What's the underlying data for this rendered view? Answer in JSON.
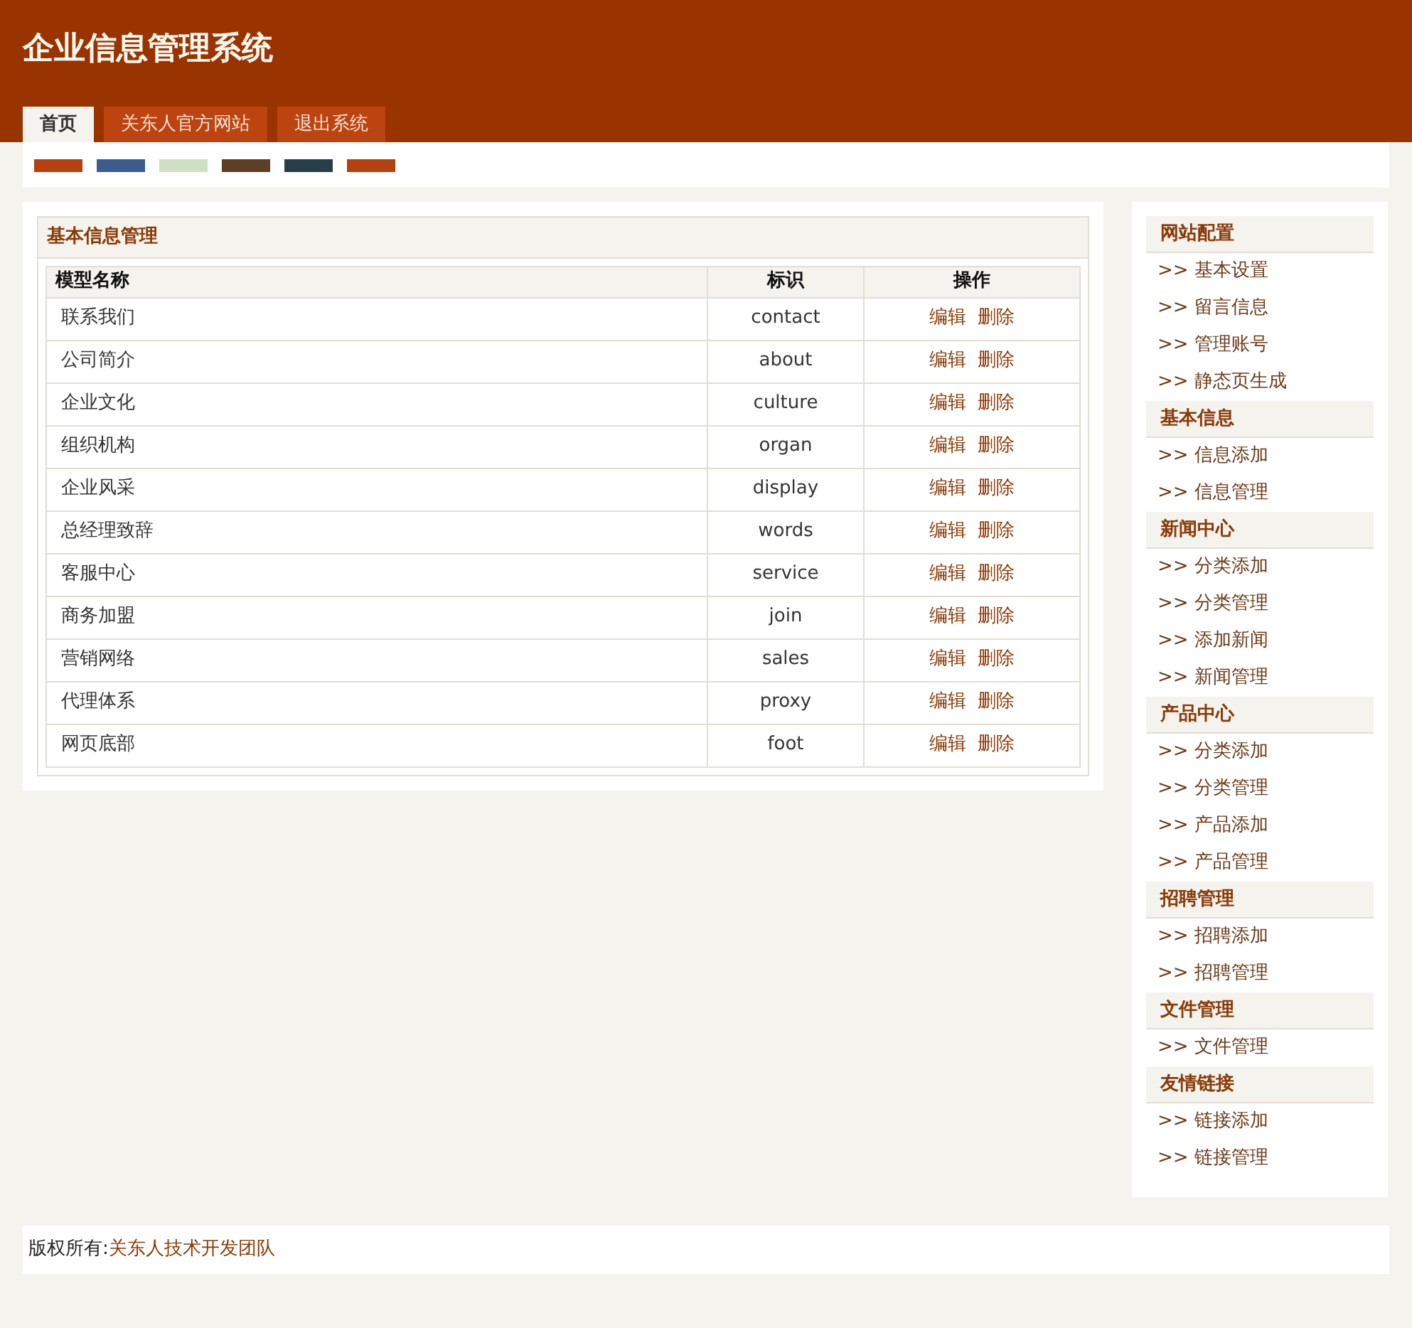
{
  "header": {
    "title": "企业信息管理系统"
  },
  "tabs": [
    {
      "label": "首页",
      "selected": true
    },
    {
      "label": "关东人官方网站",
      "selected": false
    },
    {
      "label": "退出系统",
      "selected": false
    }
  ],
  "theme_swatches": [
    {
      "color": "#b5410f"
    },
    {
      "color": "#3a5c8e"
    },
    {
      "color": "#cfe0c2"
    },
    {
      "color": "#5e3f25"
    },
    {
      "color": "#263e47"
    },
    {
      "color": "#b5410f"
    }
  ],
  "panel": {
    "title": "基本信息管理",
    "columns": [
      "模型名称",
      "标识",
      "操作"
    ],
    "rows": [
      {
        "name": "联系我们",
        "id": "contact",
        "actions": [
          "编辑",
          "删除"
        ]
      },
      {
        "name": "公司简介",
        "id": "about",
        "actions": [
          "编辑",
          "删除"
        ]
      },
      {
        "name": "企业文化",
        "id": "culture",
        "actions": [
          "编辑",
          "删除"
        ]
      },
      {
        "name": "组织机构",
        "id": "organ",
        "actions": [
          "编辑",
          "删除"
        ]
      },
      {
        "name": "企业风采",
        "id": "display",
        "actions": [
          "编辑",
          "删除"
        ]
      },
      {
        "name": "总经理致辞",
        "id": "words",
        "actions": [
          "编辑",
          "删除"
        ]
      },
      {
        "name": "客服中心",
        "id": "service",
        "actions": [
          "编辑",
          "删除"
        ]
      },
      {
        "name": "商务加盟",
        "id": "join",
        "actions": [
          "编辑",
          "删除"
        ]
      },
      {
        "name": "营销网络",
        "id": "sales",
        "actions": [
          "编辑",
          "删除"
        ]
      },
      {
        "name": "代理体系",
        "id": "proxy",
        "actions": [
          "编辑",
          "删除"
        ]
      },
      {
        "name": "网页底部",
        "id": "foot",
        "actions": [
          "编辑",
          "删除"
        ]
      }
    ]
  },
  "sidebar": [
    {
      "title": "网站配置",
      "items": [
        ">> 基本设置",
        ">> 留言信息",
        ">> 管理账号",
        ">> 静态页生成"
      ]
    },
    {
      "title": "基本信息",
      "items": [
        ">> 信息添加",
        ">> 信息管理"
      ]
    },
    {
      "title": "新闻中心",
      "items": [
        ">> 分类添加",
        ">> 分类管理",
        ">> 添加新闻",
        ">> 新闻管理"
      ]
    },
    {
      "title": "产品中心",
      "items": [
        ">> 分类添加",
        ">> 分类管理",
        ">> 产品添加",
        ">> 产品管理"
      ]
    },
    {
      "title": "招聘管理",
      "items": [
        ">> 招聘添加",
        ">> 招聘管理"
      ]
    },
    {
      "title": "文件管理",
      "items": [
        ">> 文件管理"
      ]
    },
    {
      "title": "友情链接",
      "items": [
        ">> 链接添加",
        ">> 链接管理"
      ]
    }
  ],
  "footer": {
    "label": "版权所有:",
    "link": "关东人技术开发团队"
  }
}
